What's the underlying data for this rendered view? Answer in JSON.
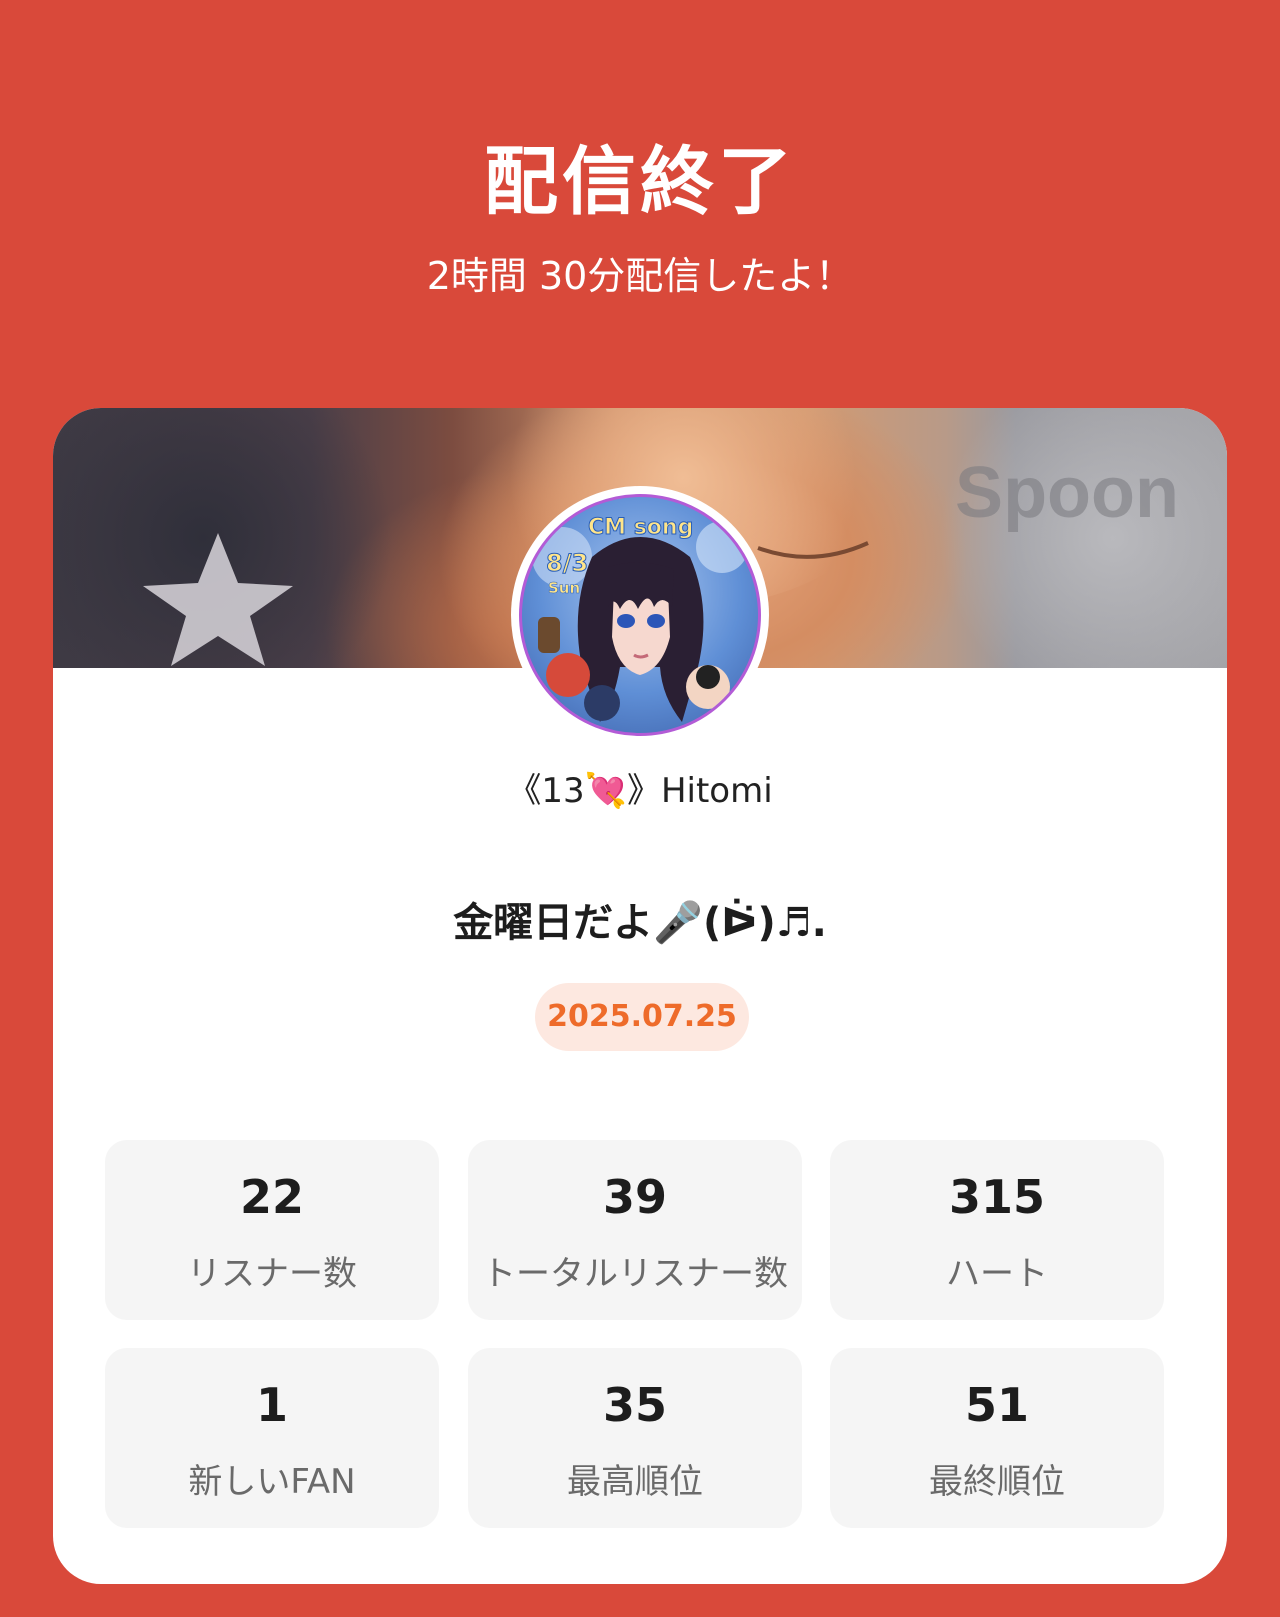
{
  "header": {
    "title": "配信終了",
    "subtitle": "2時間 30分配信したよ！"
  },
  "card": {
    "cover_watermark": "Spoon",
    "avatar": {
      "text_top": "CM song",
      "text_date": "8/3",
      "text_day": "Sun"
    },
    "username": "《13💘》Hitomi",
    "live_title": "金曜日だよ🎤(ᐖ)♬.",
    "date": "2025.07.25"
  },
  "stats": [
    {
      "value": "22",
      "label": "リスナー数"
    },
    {
      "value": "39",
      "label": "トータルリスナー数"
    },
    {
      "value": "315",
      "label": "ハート"
    },
    {
      "value": "1",
      "label": "新しいFAN"
    },
    {
      "value": "35",
      "label": "最高順位"
    },
    {
      "value": "51",
      "label": "最終順位"
    }
  ],
  "colors": {
    "background": "#d9493a",
    "date_text": "#ee6b2a",
    "date_pill": "#fde8e0"
  }
}
